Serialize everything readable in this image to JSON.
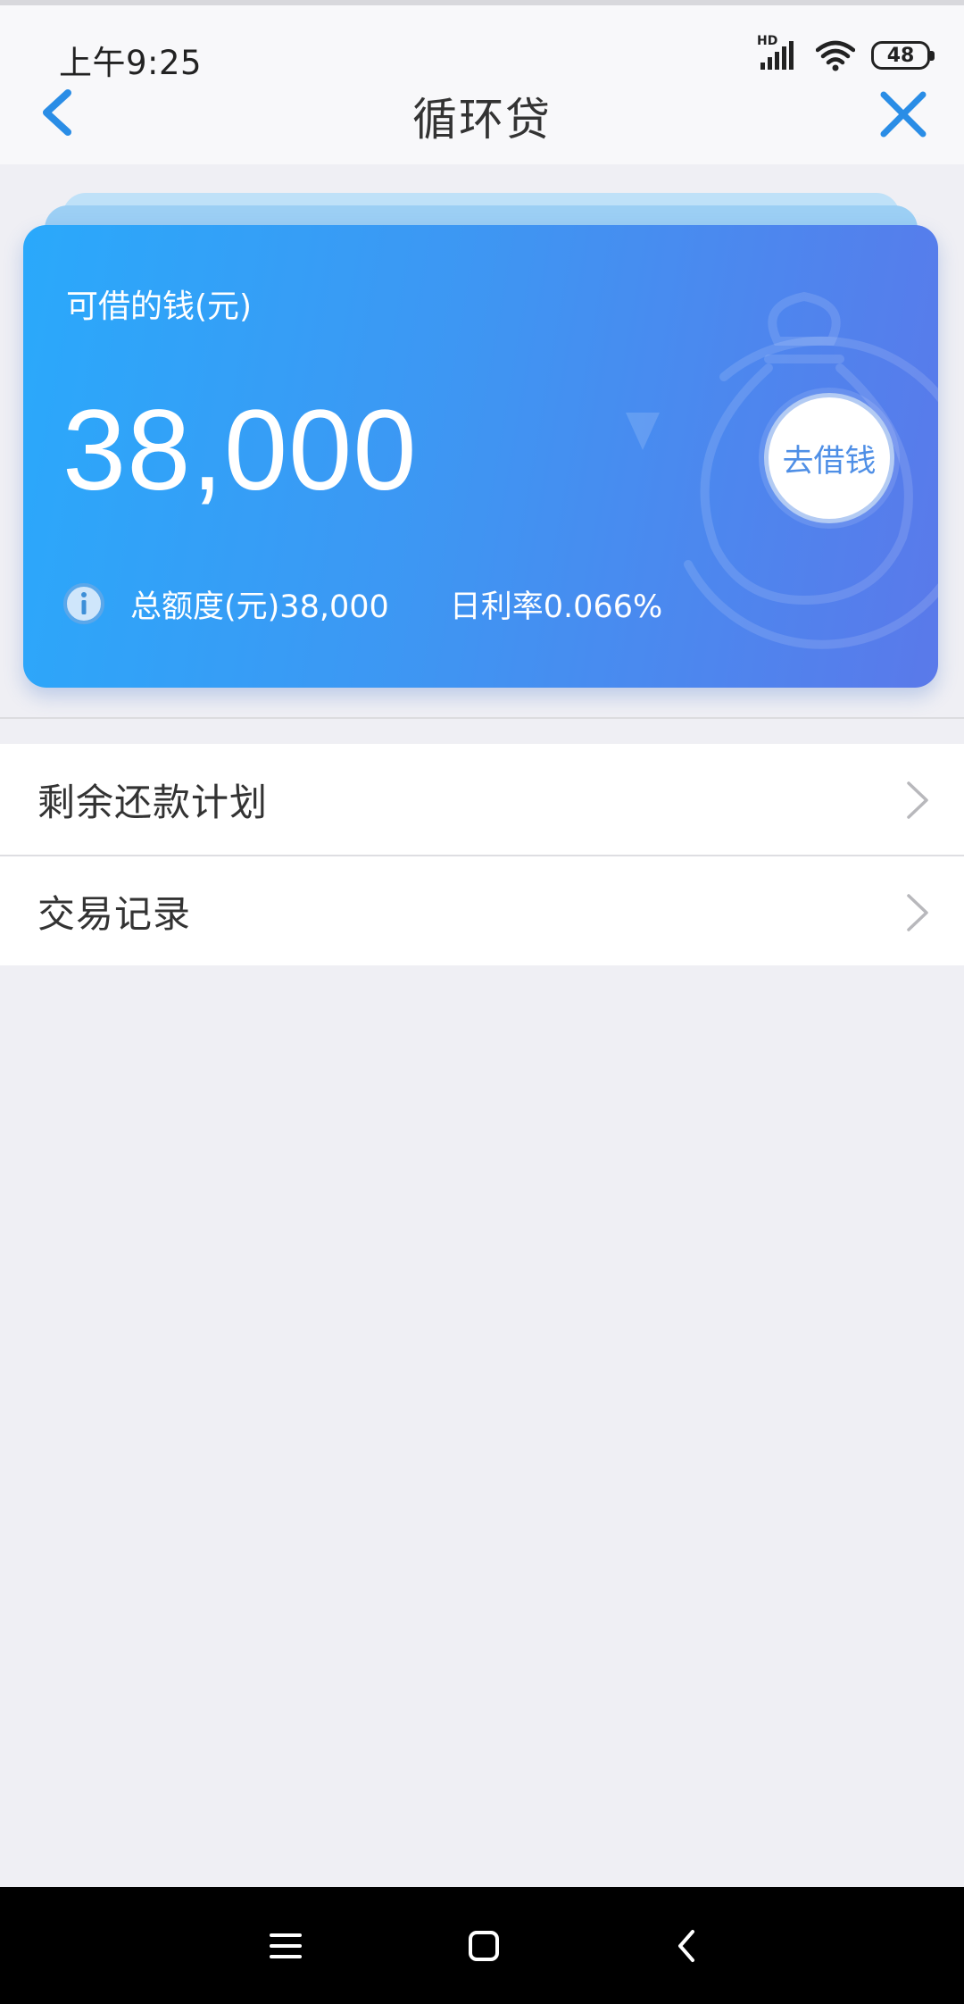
{
  "status_bar": {
    "time": "上午9:25",
    "network_label": "HD",
    "battery_level": "48"
  },
  "nav": {
    "title": "循环贷",
    "back_icon": "chevron-left-icon",
    "close_icon": "close-icon"
  },
  "card": {
    "label": "可借的钱(元)",
    "amount": "38,000",
    "borrow_button": "去借钱",
    "total_quota": "总额度(元)38,000",
    "daily_rate": "日利率0.066%",
    "gradient_start": "#2aa9fb",
    "gradient_end": "#5a79ea"
  },
  "menu": [
    {
      "label": "剩余还款计划",
      "icon": "chevron-right-icon"
    },
    {
      "label": "交易记录",
      "icon": "chevron-right-icon"
    }
  ],
  "system_nav": {
    "buttons": [
      "menu-icon",
      "home-icon",
      "back-icon"
    ]
  },
  "colors": {
    "accent": "#2a8de6",
    "page_background": "#efeff4"
  }
}
